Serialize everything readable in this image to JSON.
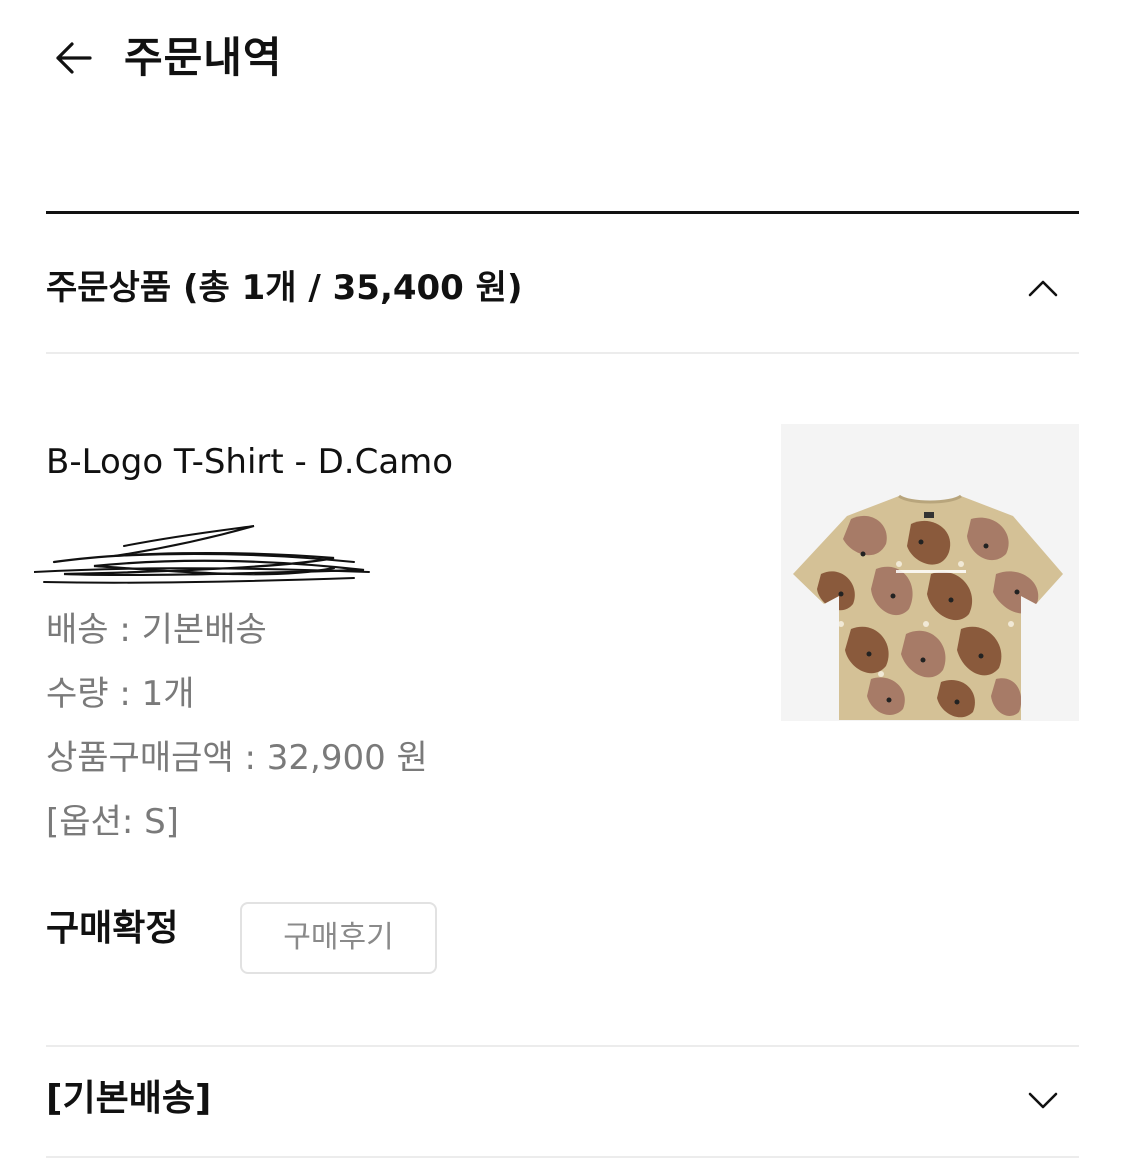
{
  "header": {
    "title": "주문내역"
  },
  "order_section": {
    "title": "주문상품 (총 1개 / 35,400 원)"
  },
  "item": {
    "name": "B-Logo T-Shirt - D.Camo",
    "shipping": "배송 : 기본배송",
    "quantity": "수량 : 1개",
    "price": "상품구매금액 : 32,900 원",
    "option": "[옵션: S]",
    "image_icon": "camo-tshirt-image"
  },
  "status": {
    "label": "구매확정",
    "review_button": "구매후기"
  },
  "shipping_section": {
    "title": "[기본배송]"
  },
  "colors": {
    "text_primary": "#111111",
    "text_secondary": "#7a7a7a",
    "divider": "#ececec",
    "camo_base": "#d4c196",
    "camo_brown": "#8a5a3c",
    "camo_mauve": "#a77b67"
  }
}
